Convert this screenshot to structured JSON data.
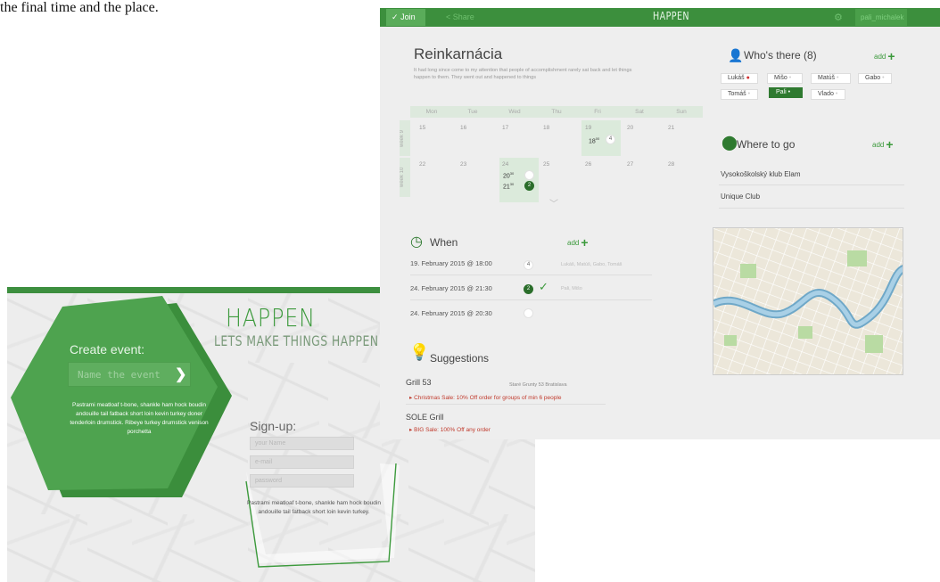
{
  "caption": "the final time and the place.",
  "signup_screen": {
    "logo": "HAPPEN",
    "tagline": "LETS MAKE THINGS HAPPEN TOGETH",
    "create_event_label": "Create event:",
    "name_event_placeholder": "Name the event",
    "description": "Pastrami meatloaf t-bone, shankle ham hock boudin andouille tail fatback short loin kevin turkey doner tenderloin drumstick. Ribeye turkey drumstick venison porchetta",
    "signup_label": "Sign-up:",
    "inputs": [
      "your Name",
      "e-mail",
      "password"
    ],
    "bottom_text": "Pastrami meatloaf t-bone, shankle ham hock boudin andouille tail fatback short loin kevin turkey.",
    "colors": {
      "brand": "#3c9a3c",
      "hex_fill": "#4ea34f"
    }
  },
  "event_screen": {
    "header": {
      "join": "Join",
      "share": "Share",
      "logo": "HAPPEN",
      "user": "pali_michalek"
    },
    "title": "Reinkarnácia",
    "description": "It had long since come to my attention that people of accomplishment rarely sat back and let things happen to them. They went out and happened to things",
    "calendar": {
      "days": [
        "Mon",
        "Tue",
        "Wed",
        "Thu",
        "Fri",
        "Sat",
        "Sun"
      ],
      "weeks": [
        {
          "label": "week 9",
          "dates": [
            "15",
            "16",
            "17",
            "18",
            "19",
            "20",
            "21"
          ]
        },
        {
          "label": "week 10",
          "dates": [
            "22",
            "23",
            "24",
            "25",
            "26",
            "27",
            "28"
          ]
        }
      ],
      "events": [
        {
          "time": "18",
          "sup": "00",
          "count": "4"
        },
        {
          "time": "20",
          "sup": "30",
          "count": ""
        },
        {
          "time": "21",
          "sup": "30",
          "count": "2"
        }
      ]
    },
    "when": {
      "title": "When",
      "add": "add",
      "rows": [
        {
          "date": "19. February 2015 @ 18:00",
          "count": "4",
          "people": "Lukáš, Matúš, Gabo, Tomáš"
        },
        {
          "date": "24. February 2015 @ 21:30",
          "count": "2",
          "people": "Pali, Mišo"
        },
        {
          "date": "24. February 2015 @ 20:30",
          "count": "",
          "people": ""
        }
      ]
    },
    "suggestions": {
      "title": "Suggestions",
      "items": [
        {
          "name": "Grill 53",
          "address": "Staré Grunty 53 Bratislava",
          "deal": "Christmas Sale: 10% Off order for groups of min 6 people"
        },
        {
          "name": "SOLE Grill",
          "address": "",
          "deal": "BIG Sale: 100% Off any order"
        }
      ]
    },
    "whos_there": {
      "title": "Who's there (8)",
      "add": "add",
      "people": [
        "Lukáš",
        "Mišo",
        "Matúš",
        "Gabo",
        "Tomáš",
        "Pali",
        "Vlado"
      ]
    },
    "where": {
      "title": "Where to go",
      "add": "add",
      "places": [
        "Vysokoškolský klub Elam",
        "Unique Club"
      ]
    },
    "colors": {
      "brand": "#3c8f3d",
      "selected": "#2f7a30",
      "deal": "#c0392b"
    }
  }
}
